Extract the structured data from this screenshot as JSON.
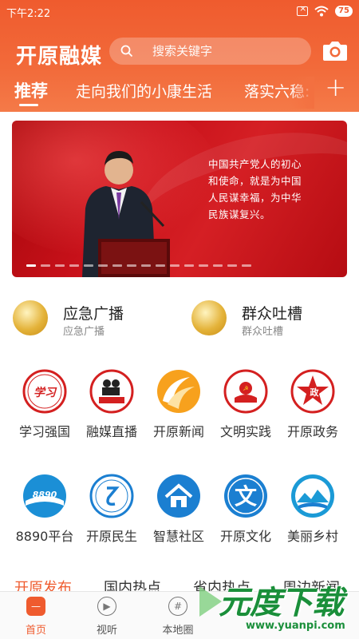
{
  "status": {
    "time": "下午2:22",
    "battery": "75"
  },
  "header": {
    "logo": "开原融媒",
    "search_placeholder": "搜索关键字"
  },
  "tabs": [
    {
      "label": "推荐",
      "active": true
    },
    {
      "label": "走向我们的小康生活"
    },
    {
      "label": "落实六稳:"
    }
  ],
  "tabs_add": "+",
  "banner": {
    "caption": "中国共产党人的初心和使命，就是为中国人民谋幸福，为中华民族谋复兴。",
    "dot_count": 16,
    "active_dot": 0
  },
  "quick_links": [
    {
      "title": "应急广播",
      "subtitle": "应急广播"
    },
    {
      "title": "群众吐槽",
      "subtitle": "群众吐槽"
    }
  ],
  "grid_row1": [
    {
      "label": "学习强国",
      "icon": "xuexi-logo-icon"
    },
    {
      "label": "融媒直播",
      "icon": "live-camera-icon"
    },
    {
      "label": "开原新闻",
      "icon": "news-swirl-icon"
    },
    {
      "label": "文明实践",
      "icon": "civilization-badge-icon"
    },
    {
      "label": "开原政务",
      "icon": "government-star-icon"
    }
  ],
  "grid_row2": [
    {
      "label": "8890平台",
      "icon": "8890-platform-icon"
    },
    {
      "label": "开原民生",
      "icon": "livelihood-icon"
    },
    {
      "label": "智慧社区",
      "icon": "house-icon"
    },
    {
      "label": "开原文化",
      "icon": "culture-wen-icon"
    },
    {
      "label": "美丽乡村",
      "icon": "village-landscape-icon"
    }
  ],
  "section_tabs": [
    {
      "label": "开原发布",
      "active": true
    },
    {
      "label": "国内热点"
    },
    {
      "label": "省内热点"
    },
    {
      "label": "周边新闻"
    }
  ],
  "bottom_nav": [
    {
      "label": "首页",
      "active": true
    },
    {
      "label": "视听"
    },
    {
      "label": "本地圈"
    }
  ],
  "watermark": {
    "title": "元度下载",
    "url": "www.yuanpi.com"
  },
  "colors": {
    "brand": "#ef5b2e",
    "banner_red": "#c8111a",
    "icon_blue": "#1b7fd1",
    "icon_red": "#d42020",
    "icon_gold": "#e4b33a"
  }
}
